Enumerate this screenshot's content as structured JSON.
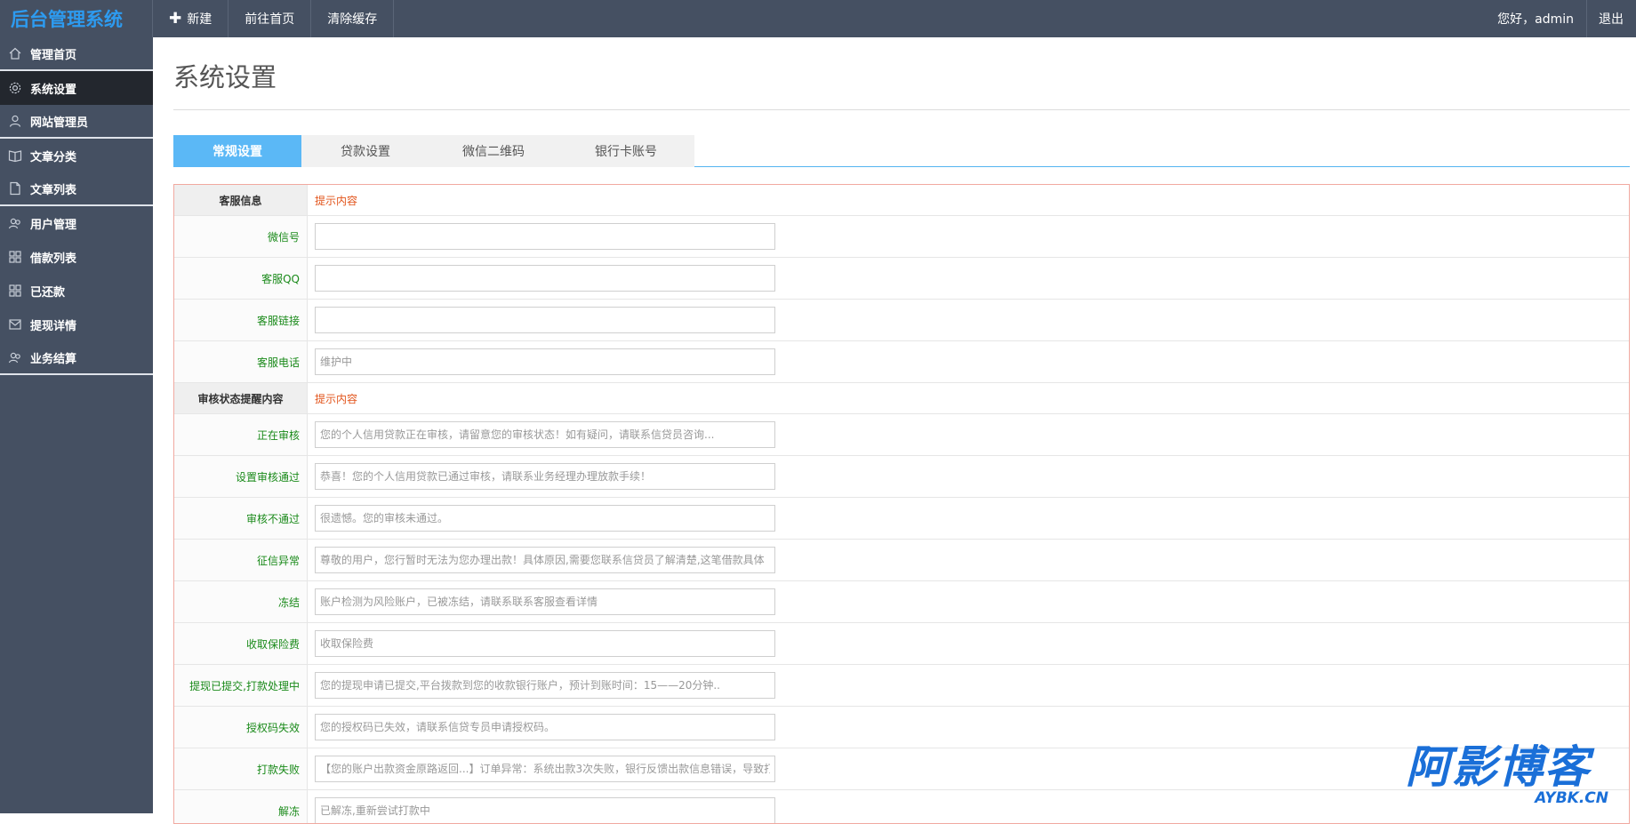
{
  "app": {
    "brand": "后台管理系统"
  },
  "topnav": {
    "new_label": "新建",
    "home_label": "前往首页",
    "clear_cache_label": "清除缓存",
    "greeting": "您好，admin",
    "logout_label": "退出"
  },
  "sidebar": {
    "items": [
      {
        "label": "管理首页",
        "icon": "home-icon"
      },
      {
        "label": "系统设置",
        "icon": "gear-icon"
      },
      {
        "label": "网站管理员",
        "icon": "user-icon"
      },
      {
        "label": "文章分类",
        "icon": "book-icon"
      },
      {
        "label": "文章列表",
        "icon": "file-icon"
      },
      {
        "label": "用户管理",
        "icon": "users-icon"
      },
      {
        "label": "借款列表",
        "icon": "grid-icon"
      },
      {
        "label": "已还款",
        "icon": "grid-icon"
      },
      {
        "label": "提现详情",
        "icon": "mail-icon"
      },
      {
        "label": "业务结算",
        "icon": "users-icon"
      }
    ],
    "active_index": 1
  },
  "page": {
    "title": "系统设置"
  },
  "tabs": [
    {
      "label": "常规设置"
    },
    {
      "label": "贷款设置"
    },
    {
      "label": "微信二维码"
    },
    {
      "label": "银行卡账号"
    }
  ],
  "form": {
    "section1": {
      "label": "客服信息",
      "hint": "提示内容"
    },
    "wechat": {
      "label": "微信号",
      "value": "",
      "placeholder": ""
    },
    "qq": {
      "label": "客服QQ",
      "value": "",
      "placeholder": ""
    },
    "link": {
      "label": "客服链接",
      "value": "",
      "placeholder": ""
    },
    "phone": {
      "label": "客服电话",
      "value": "",
      "placeholder": "维护中"
    },
    "section2": {
      "label": "审核状态提醒内容",
      "hint": "提示内容"
    },
    "reviewing": {
      "label": "正在审核",
      "placeholder": "您的个人信用贷款正在审核，请留意您的审核状态！如有疑问，请联系信贷员咨询..."
    },
    "approved": {
      "label": "设置审核通过",
      "placeholder": "恭喜！您的个人信用贷款已通过审核，请联系业务经理办理放款手续！"
    },
    "rejected": {
      "label": "审核不通过",
      "placeholder": "很遗憾。您的审核未通过。"
    },
    "credit_abnormal": {
      "label": "征信异常",
      "placeholder": "尊敬的用户，您行暂时无法为您办理出款！具体原因,需要您联系信贷员了解清楚,这笔借款具体"
    },
    "frozen": {
      "label": "冻结",
      "placeholder": "账户检测为风险账户，已被冻结，请联系联系客服查看详情"
    },
    "insurance_fee": {
      "label": "收取保险费",
      "placeholder": "收取保险费"
    },
    "withdraw_processing": {
      "label": "提现已提交,打款处理中",
      "placeholder": "您的提现申请已提交,平台拨款到您的收款银行账户，预计到账时间：15——20分钟.."
    },
    "auth_expired": {
      "label": "授权码失效",
      "placeholder": "您的授权码已失效，请联系信贷专员申请授权码。"
    },
    "payout_failed": {
      "label": "打款失败",
      "placeholder": "【您的账户出款资金原路返回...】订单异常：系统出款3次失败，银行反馈出款信息错误，导致打"
    },
    "unfreeze": {
      "label": "解冻",
      "placeholder": "已解冻,重新尝试打款中"
    }
  },
  "watermark": {
    "text": "阿影博客",
    "sub": "AYBK.CN"
  },
  "colors": {
    "topbar_bg": "#455062",
    "sidebar_active": "#23272e",
    "brand": "#2d9bf0",
    "tab_active": "#5bb8f6",
    "form_label": "#1a8a1a",
    "hint": "#e2541b",
    "form_border": "#f1a9a0"
  }
}
